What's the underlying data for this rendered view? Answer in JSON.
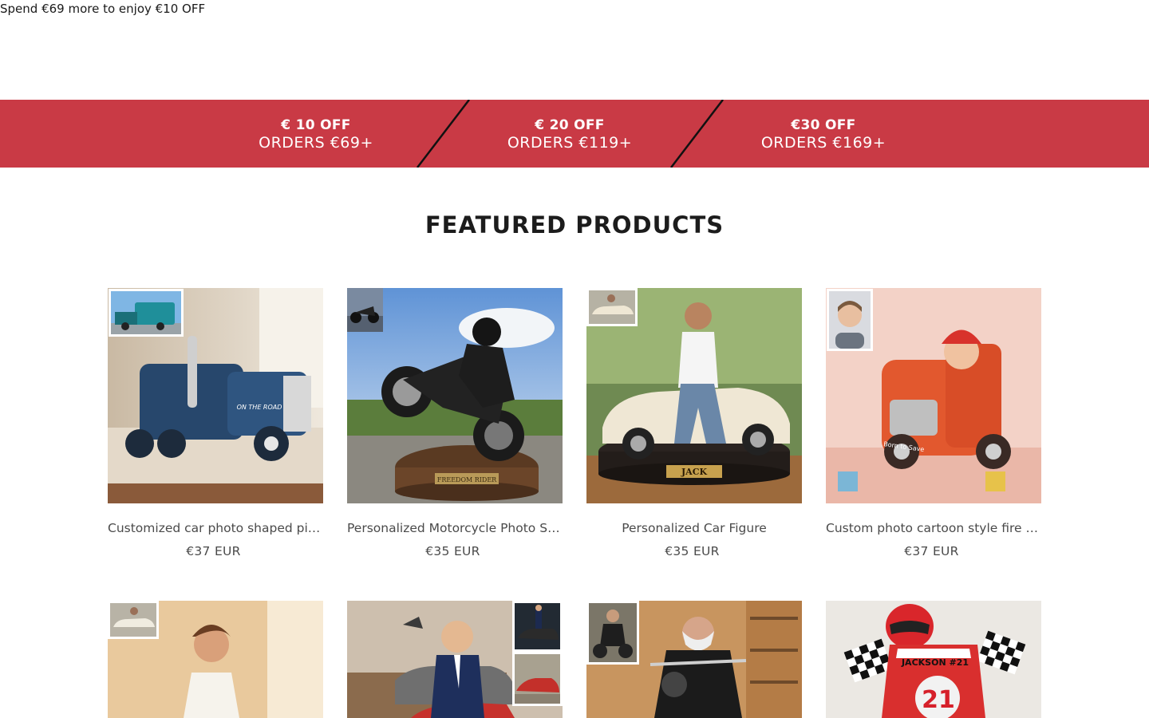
{
  "announcement": {
    "text": "Spend €69 more to enjoy €10 OFF"
  },
  "promo": {
    "tiers": [
      {
        "amount": "€ 10 OFF",
        "minimum": "ORDERS €69+"
      },
      {
        "amount": "€ 20 OFF",
        "minimum": "ORDERS €119+"
      },
      {
        "amount": "€30 OFF",
        "minimum": "ORDERS €169+"
      }
    ],
    "color": "#c93a45"
  },
  "featured": {
    "title": "FEATURED PRODUCTS",
    "products": [
      {
        "title": "Customized car photo shaped pill…",
        "price": "€37 EUR"
      },
      {
        "title": "Personalized Motorcycle Photo Sc…",
        "price": "€35 EUR"
      },
      {
        "title": "Personalized Car Figure",
        "price": "€35 EUR"
      },
      {
        "title": "Custom photo cartoon style fire tr…",
        "price": "€37 EUR"
      }
    ],
    "image_labels": {
      "truck": "ON THE ROAD",
      "moto": "FREEDOM RIDER",
      "car": "JACK",
      "fire": "Born to Save",
      "race_name": "JACKSON #21",
      "race_number": "21"
    }
  }
}
